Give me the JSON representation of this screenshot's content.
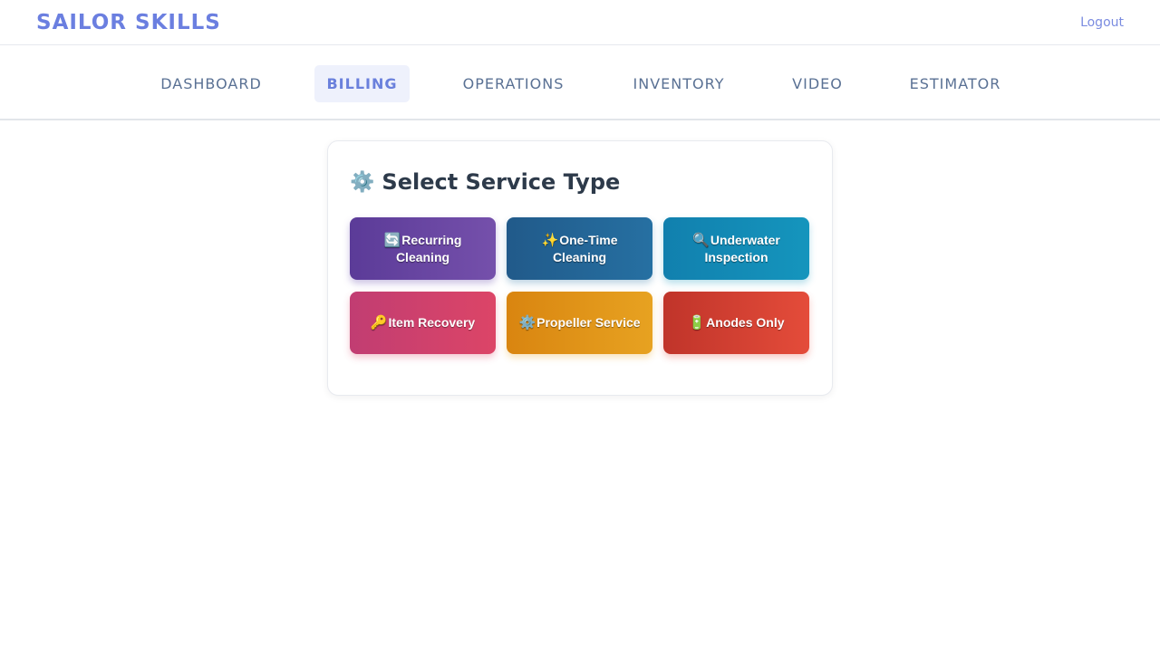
{
  "header": {
    "brand": "SAILOR SKILLS",
    "logout_label": "Logout",
    "brand_color": "#6b7fe0"
  },
  "nav": {
    "items": [
      {
        "label": "DASHBOARD"
      },
      {
        "label": "BILLING",
        "active": true
      },
      {
        "label": "OPERATIONS"
      },
      {
        "label": "INVENTORY"
      },
      {
        "label": "VIDEO"
      },
      {
        "label": "ESTIMATOR"
      }
    ]
  },
  "service_panel": {
    "title_icon": "⚙️",
    "title": "Select Service Type",
    "services": [
      {
        "icon": "🔄",
        "icon_name": "recurring-icon",
        "label": "Recurring Cleaning",
        "color": "#6b4caf"
      },
      {
        "icon": "✨",
        "icon_name": "sparkles-icon",
        "label": "One-Time Cleaning",
        "color": "#2670a2"
      },
      {
        "icon": "🔍",
        "icon_name": "magnifier-icon",
        "label": "Underwater Inspection",
        "color": "#1595bd"
      },
      {
        "icon": "🔑",
        "icon_name": "key-icon",
        "label": "Item Recovery",
        "color": "#dc4567"
      },
      {
        "icon": "⚙️",
        "icon_name": "gear-icon",
        "label": "Propeller Service",
        "color": "#e7a221"
      },
      {
        "icon": "🔋",
        "icon_name": "battery-icon",
        "label": "Anodes Only",
        "color": "#e44c3a"
      }
    ]
  }
}
